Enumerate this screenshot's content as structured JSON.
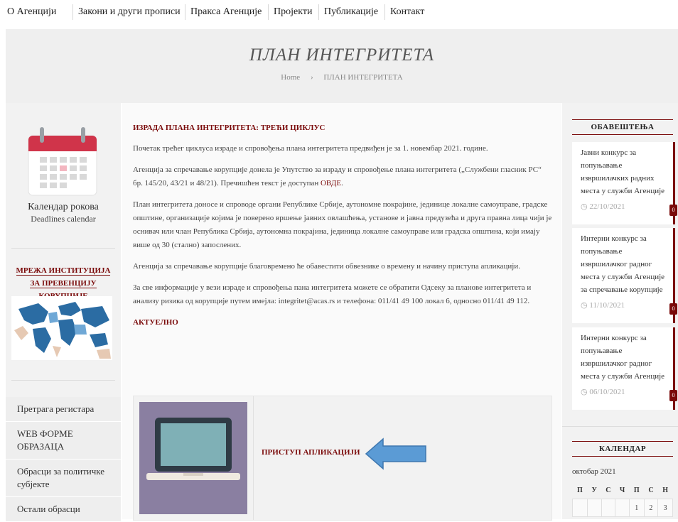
{
  "nav": [
    "О Агенцији",
    "Закони и други прописи",
    "Пракса Агенције",
    "Пројекти",
    "Публикације",
    "Контакт"
  ],
  "hero": {
    "title": "ПЛАН ИНТЕГРИТЕТА",
    "crumb_home": "Home",
    "crumb_sep": "›",
    "crumb_current": "ПЛАН ИНТЕГРИТЕТА"
  },
  "left": {
    "calendar_title": "Календар рокова",
    "calendar_sub": "Deadlines calendar",
    "network_heading": "МРЕЖА ИНСТИТУЦИЈА ЗА ПРЕВЕНЦИЈУ КОРУПЦИЈЕ",
    "links": [
      "Претрага регистара",
      "WEB ФОРМЕ ОБРАЗАЦА",
      "Обрасци за политичке субјекте",
      "Остали обрасци"
    ]
  },
  "main": {
    "heading": "ИЗРАДА ПЛАНА ИНТЕГРИТЕТА: ТРЕЋИ ЦИКЛУС",
    "p1": "Почетак трећег циклуса израде и спровођења плана интегритета предвиђен је за 1. новембар 2021. године.",
    "p2_a": "Агенција за спречавање корупције донела је Упутство за израду и спровођење плана интегритета („Службени гласник РС“ бр. 145/20, 43/21 и 48/21). Пречишћен текст је доступан ",
    "p2_link": "ОВДЕ",
    "p2_b": ".",
    "p3": "План интегритета доносе и спроводе органи Републике Србије, аутономне покрајине, јединице локалне самоуправе, градске општине, организације којима је поверено вршење јавних овлашћења, установе и јавна предузећа и друга правна лица чији је оснивач или члан Република Србија, аутономна покрајина, јединица локалне самоуправе или градска општина, који имају више од 30 (стално) запослених.",
    "p4": "Агенција за спречавање корупције благовремено ће обавестити обвезнике о времену и начину приступа апликацији.",
    "p5": "За све информације у вези израде и спровођења пана интегритета можете се обратити Одсеку за планове интегритета и анализу ризика од корупције путем имејла: integritet@acas.rs и телефона: 011/41 49 100 локал 6, односно 011/41 49 112.",
    "aktuelno": "АКТУЕЛНО",
    "app_link": "ПРИСТУП АПЛИКАЦИЈИ"
  },
  "right": {
    "notices_heading": "ОБАВЕШТЕЊА",
    "notices": [
      {
        "title": "Јавни конкурс за попуњавање извршилачких радних места у служби Агенције",
        "date": "22/10/2021",
        "count": "0"
      },
      {
        "title": "Интерни конкурс за попуњавање извршилачког радног места у служби Агенције за спречавање корупције",
        "date": "11/10/2021",
        "count": "0"
      },
      {
        "title": "Интерни конкурс за попуњавање извршилачког радног места у служби Агенције",
        "date": "06/10/2021",
        "count": "0"
      }
    ],
    "calendar_heading": "КАЛЕНДАР",
    "month": "октобар 2021",
    "weekdays": [
      "П",
      "У",
      "С",
      "Ч",
      "П",
      "С",
      "Н"
    ],
    "first_week": [
      "",
      "",
      "",
      "",
      "1",
      "2",
      "3"
    ]
  },
  "colors": {
    "accent": "#7a0a0a",
    "arrow": "#5b9bd5",
    "laptop_bg": "#8a7fa1"
  }
}
